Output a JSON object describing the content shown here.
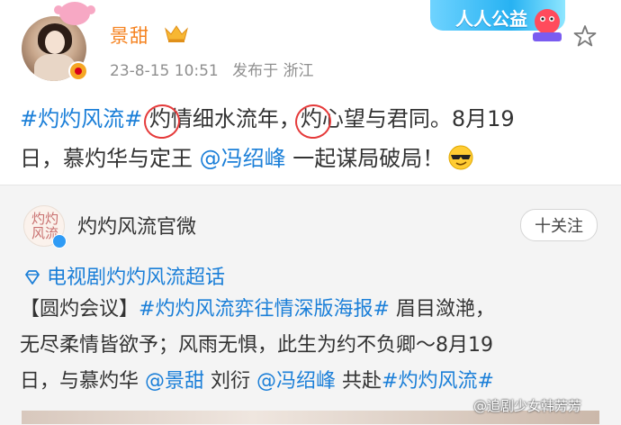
{
  "post": {
    "username": "景甜",
    "timestamp": "23-8-15 10:51",
    "location": "发布于 浙江",
    "text": {
      "topic": "#灼灼风流#",
      "line1a": " ",
      "circled1": "灼",
      "line1b": "情细水流年，",
      "circled2": "灼",
      "line1c": "心望与君同。8月19",
      "line2a": "日，慕灼华与定王 ",
      "mention": "@冯绍峰",
      "line2b": " 一起谋局破局！"
    }
  },
  "banner": {
    "text": "人人公益"
  },
  "repost": {
    "account_name": "灼灼风流官微",
    "avatar_text": "灼灼风流",
    "follow_label": "十关注",
    "supertopic": "电视剧灼灼风流超话",
    "text": {
      "p1": "【圆灼会议】",
      "topic1": "#灼灼风流弈往情深版海报#",
      "p2": " 眉目潋滟，",
      "p3": "无尽柔情皆欲予；风雨无惧，此生为约不负卿～8月19",
      "p4": "日，与慕灼华 ",
      "mention1": "@景甜",
      "p5": " 刘衍 ",
      "mention2": "@冯绍峰",
      "p6": " 共赴",
      "topic2": "#灼灼风流#"
    }
  },
  "watermark": "@追剧少女韩芳芳",
  "icons": [
    "pig-icon",
    "crown-icon",
    "verified-icon",
    "star-icon",
    "cool-emoji-icon",
    "diamond-icon"
  ],
  "colors": {
    "username": "#f5821f",
    "link": "#1b7fd8",
    "circle": "#e53a3a",
    "meta": "#8f8f8f"
  }
}
